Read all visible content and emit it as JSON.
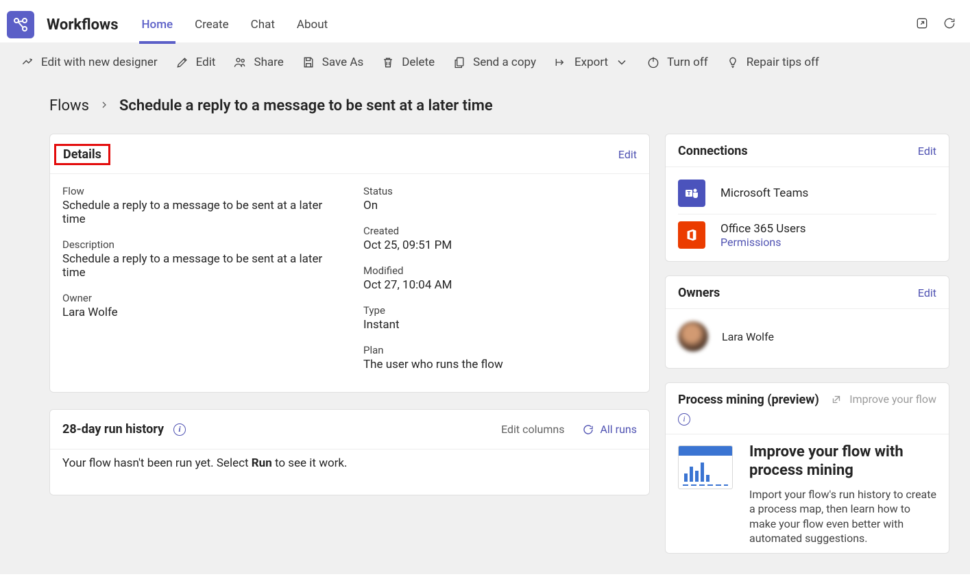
{
  "header": {
    "app_title": "Workflows",
    "tabs": [
      "Home",
      "Create",
      "Chat",
      "About"
    ],
    "active_tab_index": 0
  },
  "toolbar": {
    "edit_new_designer": "Edit with new designer",
    "edit": "Edit",
    "share": "Share",
    "save_as": "Save As",
    "delete": "Delete",
    "send_copy": "Send a copy",
    "export": "Export",
    "turn_off": "Turn off",
    "repair_tips": "Repair tips off"
  },
  "breadcrumb": {
    "root": "Flows",
    "current": "Schedule a reply to a message to be sent at a later time"
  },
  "details": {
    "title": "Details",
    "edit_label": "Edit",
    "flow_label": "Flow",
    "flow_value": "Schedule a reply to a message to be sent at a later time",
    "description_label": "Description",
    "description_value": "Schedule a reply to a message to be sent at a later time",
    "owner_label": "Owner",
    "owner_value": "Lara Wolfe",
    "status_label": "Status",
    "status_value": "On",
    "created_label": "Created",
    "created_value": "Oct 25, 09:51 PM",
    "modified_label": "Modified",
    "modified_value": "Oct 27, 10:04 AM",
    "type_label": "Type",
    "type_value": "Instant",
    "plan_label": "Plan",
    "plan_value": "The user who runs the flow"
  },
  "connections": {
    "title": "Connections",
    "edit_label": "Edit",
    "items": [
      {
        "name": "Microsoft Teams",
        "icon": "teams"
      },
      {
        "name": "Office 365 Users",
        "icon": "office",
        "link": "Permissions"
      }
    ]
  },
  "owners": {
    "title": "Owners",
    "edit_label": "Edit",
    "name": "Lara Wolfe"
  },
  "run_history": {
    "title": "28-day run history",
    "edit_columns": "Edit columns",
    "all_runs": "All runs",
    "empty_prefix": "Your flow hasn't been run yet. Select ",
    "empty_bold": "Run",
    "empty_suffix": " to see it work."
  },
  "process_mining": {
    "title": "Process mining (preview)",
    "improve_link": "Improve your flow",
    "card_title": "Improve your flow with process mining",
    "card_text": "Import your flow's run history to create a process map, then learn how to make your flow even better with automated suggestions."
  }
}
